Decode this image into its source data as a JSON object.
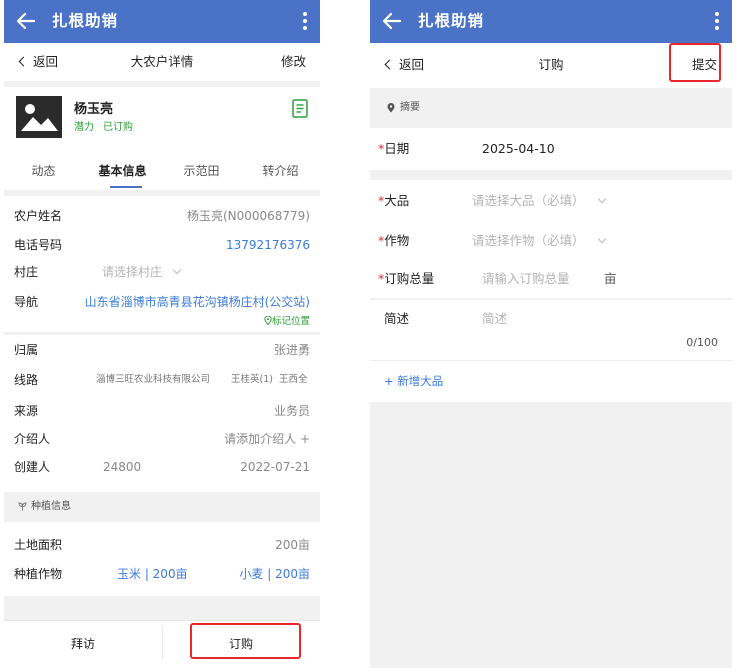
{
  "app_title": "扎根助销",
  "left": {
    "nav": {
      "back_label": "返回",
      "title": "大农户详情",
      "action": "修改"
    },
    "profile": {
      "name": "杨玉亮",
      "tags": [
        "潜力",
        "已订购"
      ]
    },
    "tabs": [
      "动态",
      "基本信息",
      "示范田",
      "转介绍"
    ],
    "active_tab": "基本信息",
    "fields": {
      "name_label": "农户姓名",
      "name_value": "杨玉亮(N000068779)",
      "phone_label": "电话号码",
      "phone_value": "13792176376",
      "village_label": "村庄",
      "village_placeholder": "请选择村庄",
      "nav_label": "导航",
      "nav_value": "山东省淄博市高青县花沟镇杨庄村(公交站)",
      "mark_location": "标记位置",
      "belong_label": "归属",
      "belong_value": "张进勇",
      "route_label": "线路",
      "route_company": "淄博三旺农业科技有限公司",
      "route_p1": "王桂英(1)",
      "route_p2": "王西全",
      "source_label": "来源",
      "source_value": "业务员",
      "introducer_label": "介绍人",
      "introducer_placeholder": "请添加介绍人 +",
      "creator_label": "创建人",
      "creator_id": "24800",
      "creator_date": "2022-07-21"
    },
    "planting": {
      "section_title": "种植信息",
      "area_label": "土地面积",
      "area_value": "200亩",
      "crops_label": "种植作物",
      "crop1": "玉米 | 200亩",
      "crop2": "小麦 | 200亩"
    },
    "bottom": {
      "visit": "拜访",
      "order": "订购"
    }
  },
  "right": {
    "nav": {
      "back_label": "返回",
      "title": "订购",
      "action": "提交"
    },
    "summary_title": "摘要",
    "form": {
      "date_label": "日期",
      "date_value": "2025-04-10",
      "product_label": "大品",
      "product_placeholder": "请选择大品（必填）",
      "crop_label": "作物",
      "crop_placeholder": "请选择作物（必填）",
      "total_label": "订购总量",
      "total_placeholder": "请输入订购总量",
      "total_unit": "亩",
      "desc_label": "简述",
      "desc_placeholder": "简述",
      "desc_counter": "0/100"
    },
    "add_product": "+ 新增大品"
  },
  "colors": {
    "primary": "#4a72c6",
    "highlight": "#e8262c",
    "link": "#3b7bd8",
    "tag": "#2e9d3a"
  }
}
